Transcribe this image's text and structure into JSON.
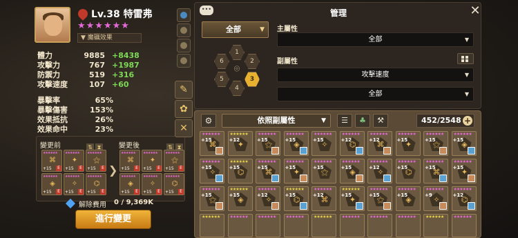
{
  "hero": {
    "level": "Lv.38",
    "name": "特雷弗",
    "stars": "★★★★★★",
    "effect_label": "魔礪效果",
    "stats": [
      {
        "label": "體力",
        "value": "9885",
        "bonus": "+8438"
      },
      {
        "label": "攻擊力",
        "value": "767",
        "bonus": "+1987"
      },
      {
        "label": "防禦力",
        "value": "519",
        "bonus": "+316"
      },
      {
        "label": "攻擊速度",
        "value": "107",
        "bonus": "+60"
      }
    ],
    "stats2": [
      {
        "label": "暴擊率",
        "value": "65%"
      },
      {
        "label": "暴擊傷害",
        "value": "153%"
      },
      {
        "label": "效果抵抗",
        "value": "26%"
      },
      {
        "label": "效果命中",
        "value": "23%"
      }
    ]
  },
  "change": {
    "before_label": "變更前",
    "after_label": "變更後",
    "rune_level": "+15",
    "rune_tag": "E",
    "cost_label": "解除費用",
    "cost_value": "0 / 9,369K",
    "button_label": "進行變更"
  },
  "management": {
    "title": "管理",
    "set_filter": "全部",
    "slots": [
      "1",
      "2",
      "3",
      "4",
      "5",
      "6"
    ],
    "selected_slot": "3",
    "main_stat_label": "主屬性",
    "main_stat_value": "全部",
    "sub_stat_label": "副屬性",
    "sub_stat_value1": "攻擊速度",
    "sub_stat_value2": "全部"
  },
  "inventory": {
    "sort_label": "依照副屬性",
    "count": "452/2548",
    "rows": [
      [
        "+15",
        "+12",
        "+15",
        "+15",
        "+15",
        "+12",
        "+12",
        "+15",
        "+15",
        "+15"
      ],
      [
        "+15",
        "+15",
        "+15",
        "+15",
        "+15",
        "+15",
        "+12",
        "+15",
        "+15",
        "+15"
      ],
      [
        "+15",
        "+15",
        "+12",
        "+15",
        "+12",
        "+15",
        "+15",
        "+15",
        "+9",
        "+12"
      ]
    ]
  }
}
